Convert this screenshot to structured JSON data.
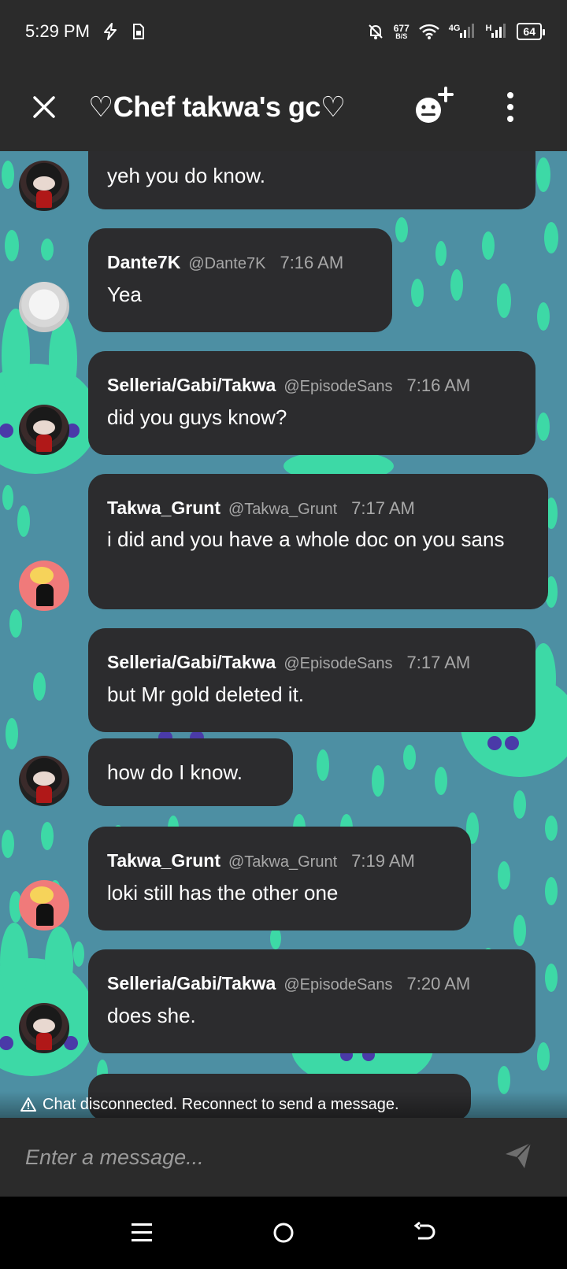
{
  "status_bar": {
    "time": "5:29 PM",
    "net_speed_value": "677",
    "net_speed_unit": "B/S",
    "signal_1": "4G",
    "signal_2": "H",
    "battery": "64"
  },
  "header": {
    "title": "♡Chef takwa's gc♡"
  },
  "messages": [
    {
      "text": "yeh you do know."
    },
    {
      "name": "Dante7K",
      "handle": "@Dante7K",
      "time": "7:16 AM",
      "text": "Yea"
    },
    {
      "name": "Selleria/Gabi/Takwa",
      "handle": "@EpisodeSans",
      "time": "7:16 AM",
      "text": "did you guys know?"
    },
    {
      "name": "Takwa_Grunt",
      "handle": "@Takwa_Grunt",
      "time": "7:17 AM",
      "text": "i did and you have a whole doc on you sans"
    },
    {
      "name": "Selleria/Gabi/Takwa",
      "handle": "@EpisodeSans",
      "time": "7:17 AM",
      "text": "but Mr gold deleted it."
    },
    {
      "text": "how do I know."
    },
    {
      "name": "Takwa_Grunt",
      "handle": "@Takwa_Grunt",
      "time": "7:19 AM",
      "text": "loki still has the other one"
    },
    {
      "name": "Selleria/Gabi/Takwa",
      "handle": "@EpisodeSans",
      "time": "7:20 AM",
      "text": "does she."
    }
  ],
  "notice": "Chat disconnected. Reconnect to send a message.",
  "composer": {
    "placeholder": "Enter a message..."
  },
  "colors": {
    "chat_background": "#4d8fa3",
    "pattern": "#3dd9a6",
    "bubble": "#2c2c2e",
    "header": "#2b2b2b"
  },
  "icons": {
    "close": "close-icon",
    "add_member": "add-member-icon",
    "more": "more-vertical-icon",
    "send": "send-icon",
    "warning": "warning-icon"
  }
}
